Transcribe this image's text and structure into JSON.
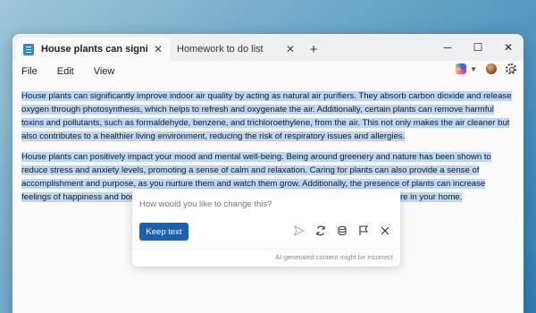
{
  "tabs": [
    {
      "label": "House plants can significan",
      "active": true
    },
    {
      "label": "Homework to do list",
      "active": false
    }
  ],
  "new_tab_symbol": "+",
  "window_controls": {
    "minimize": "─",
    "maximize": "☐",
    "close": "✕"
  },
  "menu": [
    "File",
    "Edit",
    "View"
  ],
  "menu_icons": [
    "copilot-icon",
    "chevron-down-icon",
    "avatar",
    "gear-icon"
  ],
  "document": {
    "paragraphs": [
      "House plants can significantly improve indoor air quality by acting as natural air purifiers. They absorb carbon dioxide and release oxygen through photosynthesis, which helps to refresh and oxygenate the air. Additionally, certain plants can remove harmful toxins and pollutants, such as formaldehyde, benzene, and trichloroethylene, from the air. This not only makes the air cleaner but also contributes to a healthier living environment, reducing the risk of respiratory issues and allergies.",
      "House plants can positively impact your mood and mental well-being. Being around greenery and nature has been shown to reduce stress and anxiety levels, promoting a sense of calm and relaxation. Caring for plants can also provide a sense of accomplishment and purpose, as you nurture them and watch them grow. Additionally, the presence of plants can increase feelings of happiness and boost your overall mood, creating a more pleasant and uplifting atmosphere in your home."
    ],
    "highlight_color": "#bcd6f3"
  },
  "rewrite": {
    "placeholder": "How would you like to change this?",
    "keep_label": "Keep text",
    "icons": [
      "send-icon",
      "regenerate-icon",
      "stack-icon",
      "flag-icon",
      "close-icon"
    ],
    "disclaimer": "AI-generated content might be incorrect"
  },
  "colors": {
    "accent": "#1f5fb0",
    "tab_icon": "#2e88d6"
  }
}
